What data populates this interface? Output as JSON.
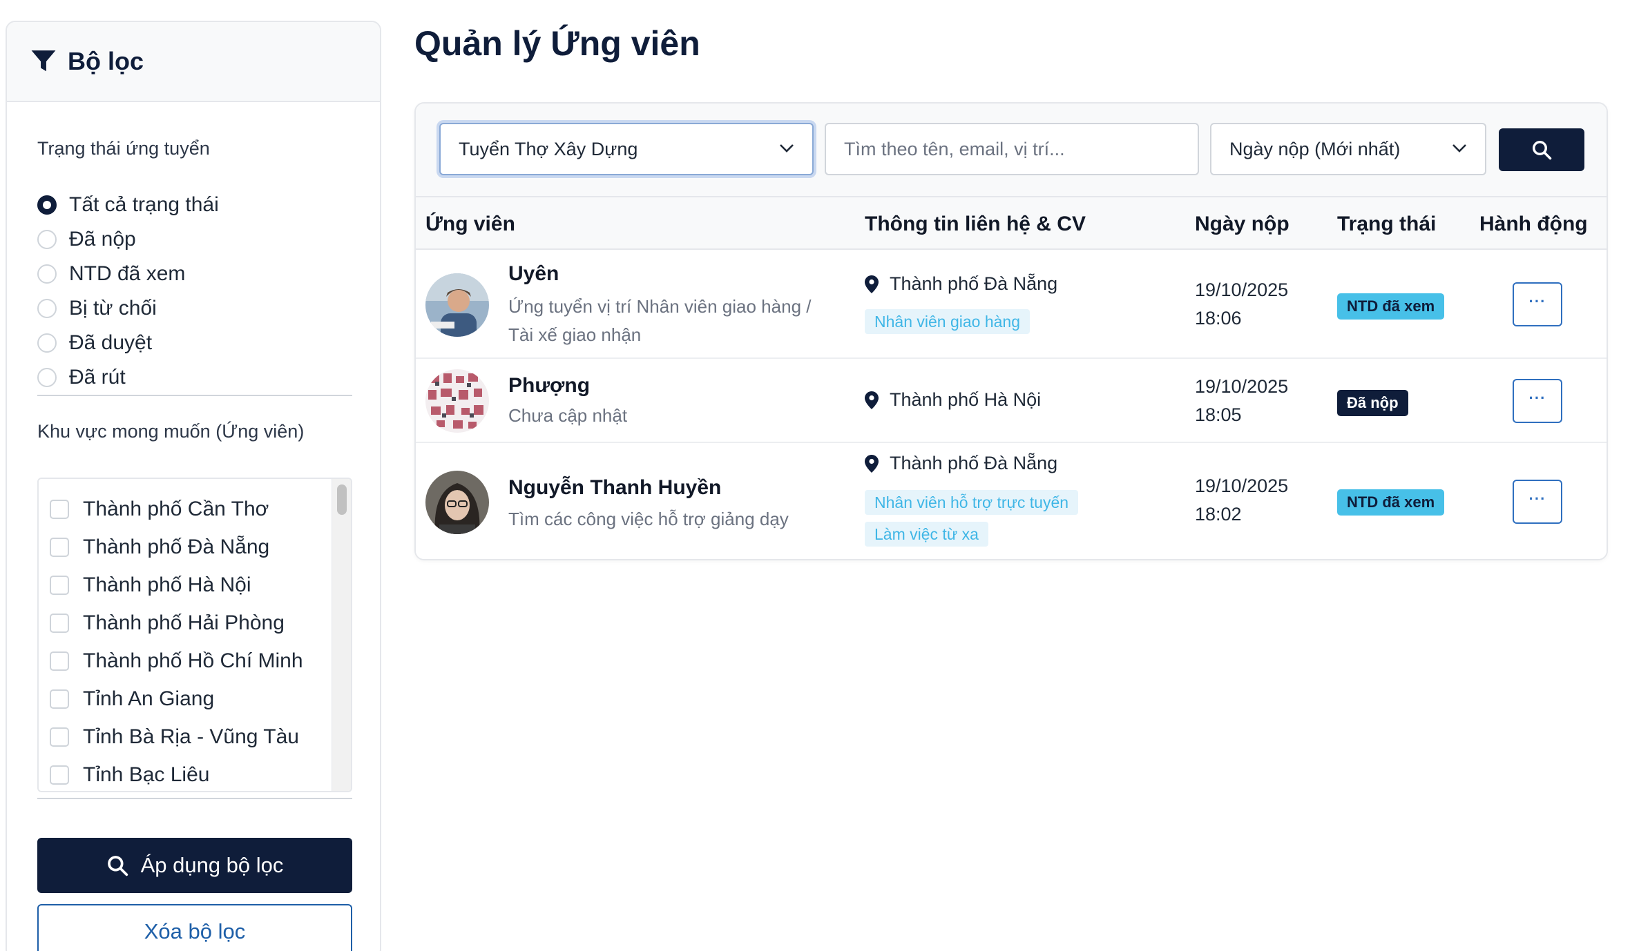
{
  "sidebar": {
    "title": "Bộ lọc",
    "status_label": "Trạng thái ứng tuyển",
    "statuses": [
      {
        "label": "Tất cả trạng thái",
        "checked": true
      },
      {
        "label": "Đã nộp",
        "checked": false
      },
      {
        "label": "NTD đã xem",
        "checked": false
      },
      {
        "label": "Bị từ chối",
        "checked": false
      },
      {
        "label": "Đã duyệt",
        "checked": false
      },
      {
        "label": "Đã rút",
        "checked": false
      }
    ],
    "region_label": "Khu vực mong muốn (Ứng viên)",
    "regions": [
      "Thành phố Cần Thơ",
      "Thành phố Đà Nẵng",
      "Thành phố Hà Nội",
      "Thành phố Hải Phòng",
      "Thành phố Hồ Chí Minh",
      "Tỉnh An Giang",
      "Tỉnh Bà Rịa - Vũng Tàu",
      "Tỉnh Bạc Liêu"
    ],
    "apply_label": "Áp dụng bộ lọc",
    "clear_label": "Xóa bộ lọc"
  },
  "main": {
    "title": "Quản lý Ứng viên",
    "toolbar": {
      "job_select": "Tuyển Thợ Xây Dựng",
      "search_placeholder": "Tìm theo tên, email, vị trí...",
      "sort_select": "Ngày nộp (Mới nhất)"
    },
    "columns": [
      "Ứng viên",
      "Thông tin liên hệ & CV",
      "Ngày nộp",
      "Trạng thái",
      "Hành động"
    ],
    "rows": [
      {
        "name": "Uyên",
        "subtitle": "Ứng tuyển vị trí Nhân viên giao hàng / Tài xế giao nhận",
        "location": "Thành phố Đà Nẵng",
        "tags": [
          "Nhân viên giao hàng"
        ],
        "date": "19/10/2025",
        "time": "18:06",
        "status": "NTD đã xem"
      },
      {
        "name": "Phượng",
        "subtitle": "Chưa cập nhật",
        "location": "Thành phố Hà Nội",
        "tags": [],
        "date": "19/10/2025",
        "time": "18:05",
        "status": "Đã nộp"
      },
      {
        "name": "Nguyễn Thanh Huyền",
        "subtitle": "Tìm các công việc hỗ trợ giảng dạy",
        "location": "Thành phố Đà Nẵng",
        "tags": [
          "Nhân viên hỗ trợ trực tuyến",
          "Làm việc từ xa"
        ],
        "date": "19/10/2025",
        "time": "18:02",
        "status": "NTD đã xem"
      }
    ],
    "more_label": "···"
  },
  "colors": {
    "primary": "#0f1d3a",
    "accent_blue": "#1e5fa8",
    "badge_seen": "#47c0e8",
    "tag_bg": "#e6f4fb",
    "tag_text": "#3fb6e6"
  }
}
